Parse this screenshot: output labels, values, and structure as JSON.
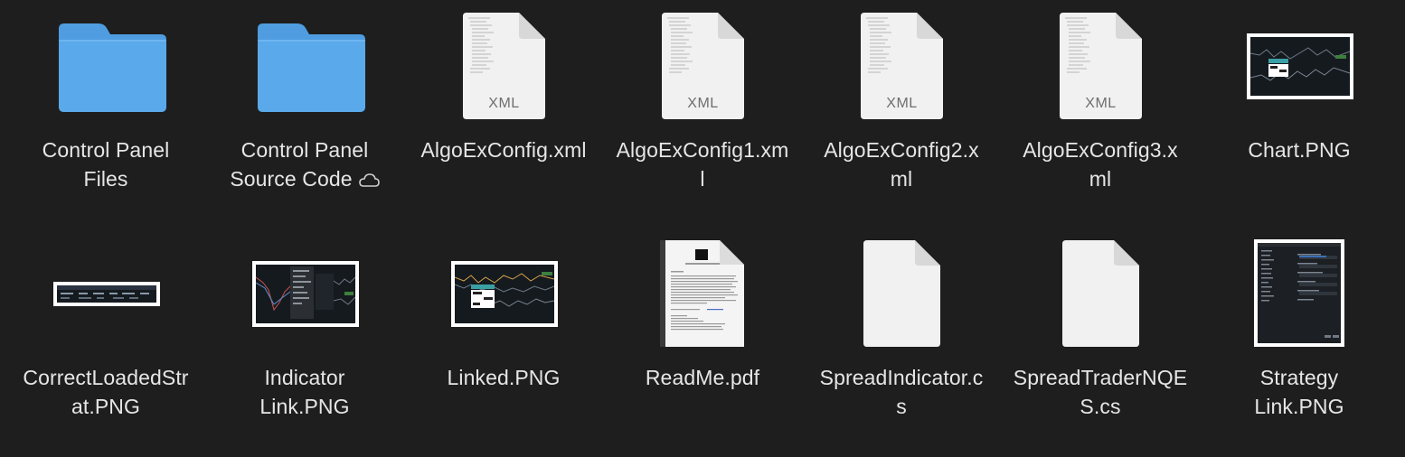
{
  "items": [
    {
      "name_line1": "Control Panel",
      "name_line2": "Files",
      "kind": "folder"
    },
    {
      "name_line1": "Control Panel",
      "name_line2": "Source Code",
      "kind": "folder",
      "badge": "cloud-icon"
    },
    {
      "name_line1": "AlgoExConfig.xml",
      "name_line2": "",
      "kind": "document",
      "type_label": "XML"
    },
    {
      "name_line1": "AlgoExConfig1.xm",
      "name_line2": "l",
      "kind": "document",
      "type_label": "XML"
    },
    {
      "name_line1": "AlgoExConfig2.x",
      "name_line2": "ml",
      "kind": "document",
      "type_label": "XML"
    },
    {
      "name_line1": "AlgoExConfig3.x",
      "name_line2": "ml",
      "kind": "document",
      "type_label": "XML"
    },
    {
      "name_line1": "Chart.PNG",
      "name_line2": "",
      "kind": "image-thumbnail"
    },
    {
      "name_line1": "CorrectLoadedStr",
      "name_line2": "at.PNG",
      "kind": "image-thumbnail"
    },
    {
      "name_line1": "Indicator",
      "name_line2": "Link.PNG",
      "kind": "image-thumbnail"
    },
    {
      "name_line1": "Linked.PNG",
      "name_line2": "",
      "kind": "image-thumbnail"
    },
    {
      "name_line1": "ReadMe.pdf",
      "name_line2": "",
      "kind": "pdf-thumbnail"
    },
    {
      "name_line1": "SpreadIndicator.c",
      "name_line2": "s",
      "kind": "document"
    },
    {
      "name_line1": "SpreadTraderNQE",
      "name_line2": "S.cs",
      "kind": "document"
    },
    {
      "name_line1": "Strategy",
      "name_line2": "Link.PNG",
      "kind": "image-thumbnail"
    }
  ],
  "colors": {
    "background": "#1e1e1e",
    "label": "#e6e6e6",
    "folder": "#5aa9ea",
    "folder_tab": "#66b3f0",
    "document": "#f1f1f1",
    "document_fold": "#d8d8d8",
    "type_label": "#6e6e6e"
  }
}
